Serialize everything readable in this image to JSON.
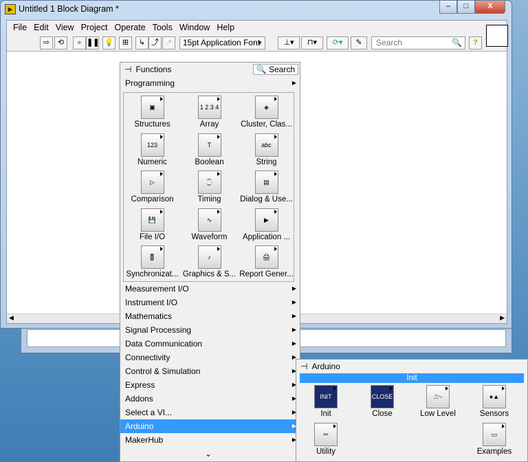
{
  "window": {
    "title": "Untitled 1 Block Diagram *",
    "minimize": "–",
    "maximize": "□",
    "close": "X"
  },
  "menu": [
    "File",
    "Edit",
    "View",
    "Project",
    "Operate",
    "Tools",
    "Window",
    "Help"
  ],
  "toolbar": {
    "font": "15pt Application Font",
    "search_placeholder": "Search",
    "help": "?"
  },
  "functions": {
    "title": "Functions",
    "search": "Search",
    "top_category": "Programming",
    "icons": [
      {
        "label": "Structures",
        "glyph": "▣"
      },
      {
        "label": "Array",
        "glyph": "1 2 3 4"
      },
      {
        "label": "Cluster, Clas...",
        "glyph": "◈"
      },
      {
        "label": "Numeric",
        "glyph": "123"
      },
      {
        "label": "Boolean",
        "glyph": "T"
      },
      {
        "label": "String",
        "glyph": "abc"
      },
      {
        "label": "Comparison",
        "glyph": "▷"
      },
      {
        "label": "Timing",
        "glyph": "⌚"
      },
      {
        "label": "Dialog & Use...",
        "glyph": "▤"
      },
      {
        "label": "File I/O",
        "glyph": "💾"
      },
      {
        "label": "Waveform",
        "glyph": "∿"
      },
      {
        "label": "Application ...",
        "glyph": "▶"
      },
      {
        "label": "Synchronizat...",
        "glyph": "🚦"
      },
      {
        "label": "Graphics & S...",
        "glyph": "♪"
      },
      {
        "label": "Report Gener...",
        "glyph": "🖨"
      }
    ],
    "categories": [
      "Measurement I/O",
      "Instrument I/O",
      "Mathematics",
      "Signal Processing",
      "Data Communication",
      "Connectivity",
      "Control & Simulation",
      "Express",
      "Addons",
      "Select a VI...",
      "Arduino",
      "MakerHub"
    ],
    "selected": "Arduino",
    "more": "⌄"
  },
  "arduino": {
    "title": "Arduino",
    "highlight": "Init",
    "icons": [
      {
        "label": "Init",
        "glyph": "INIT"
      },
      {
        "label": "Close",
        "glyph": "CLOSE"
      },
      {
        "label": "Low Level",
        "glyph": "⎍∿"
      },
      {
        "label": "Sensors",
        "glyph": "●▲"
      },
      {
        "label": "Utility",
        "glyph": "✂"
      },
      {
        "label": "Examples",
        "glyph": "▭"
      }
    ]
  }
}
